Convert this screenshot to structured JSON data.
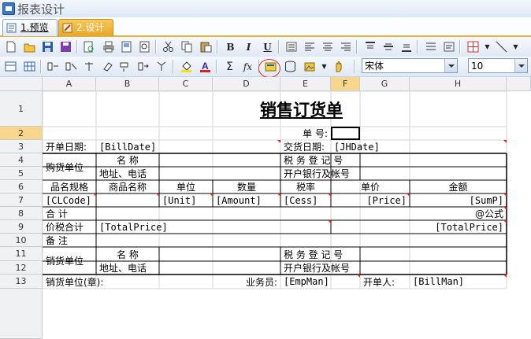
{
  "app": {
    "title": "报表设计"
  },
  "tabs": [
    {
      "label": "1.预览"
    },
    {
      "label": "2.设计"
    }
  ],
  "toolbar": {
    "font_name": "宋体",
    "font_size": "10"
  },
  "columns": [
    "A",
    "B",
    "C",
    "D",
    "E",
    "F",
    "G",
    "H"
  ],
  "rows": [
    "1",
    "2",
    "3",
    "4",
    "5",
    "6",
    "7",
    "8",
    "9",
    "10",
    "11",
    "12",
    "13"
  ],
  "report": {
    "title": "销售订货单",
    "bill_no_label": "单    号:",
    "bill_date_label": "开单日期:",
    "bill_date_field": "[BillDate]",
    "delivery_date_label": "交货日期:",
    "delivery_date_field": "[JHDate]",
    "buyer_label": "购货单位",
    "seller_label": "销货单位",
    "name_label": "名      称",
    "addr_label": "地址、电话",
    "tax_label": "税 务 登 记 号",
    "bank_label": "开户银行及帐号",
    "col_headers": [
      "品名规格",
      "商品名称",
      "单位",
      "数量",
      "税率",
      "单价",
      "金额"
    ],
    "detail_fields": [
      "[CLCode]",
      "[Unit]",
      "[Amount]",
      "[Cess]",
      "[Price]",
      "[SumP]"
    ],
    "total_label": "合    计",
    "total_formula": "@公式",
    "tax_total_label": "价税合计",
    "total_price_field": "[TotalPrice]",
    "remark_label": "备    注",
    "seller_seal_label": "销货单位(章):",
    "salesman_label": "业务员:",
    "emp_field": "[EmpMan]",
    "biller_label": "开单人:",
    "biller_field": "[BillMan]"
  }
}
